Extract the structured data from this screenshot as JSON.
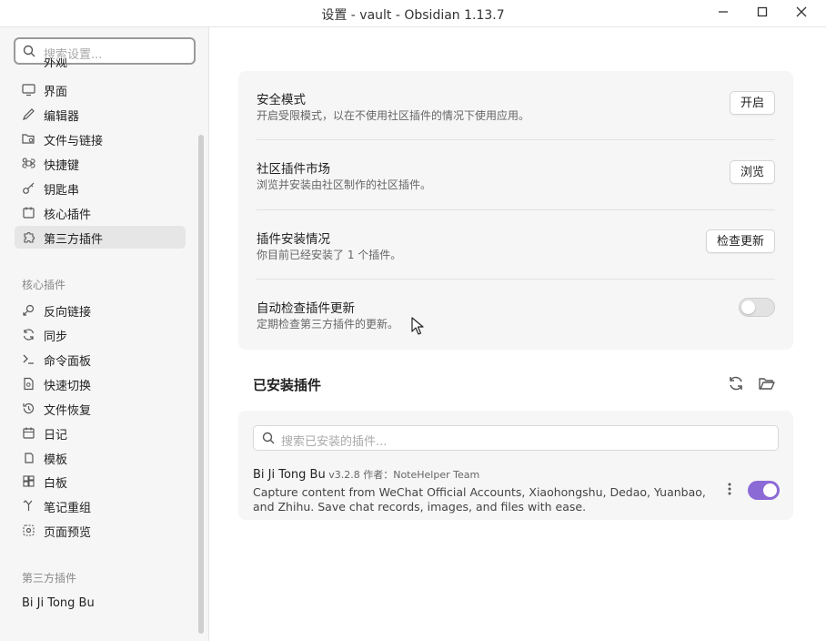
{
  "window": {
    "title": "设置 - vault - Obsidian 1.13.7"
  },
  "sidebar": {
    "search_placeholder": "搜索设置...",
    "partial_item": "外观",
    "items": [
      {
        "label": "界面",
        "icon": "monitor-icon"
      },
      {
        "label": "编辑器",
        "icon": "pen-icon"
      },
      {
        "label": "文件与链接",
        "icon": "folder-cog-icon"
      },
      {
        "label": "快捷键",
        "icon": "command-icon"
      },
      {
        "label": "钥匙串",
        "icon": "key-icon"
      },
      {
        "label": "核心插件",
        "icon": "calendar-icon"
      },
      {
        "label": "第三方插件",
        "icon": "puzzle-icon",
        "active": true
      }
    ],
    "core_heading": "核心插件",
    "core_items": [
      {
        "label": "反向链接",
        "icon": "backlink-icon"
      },
      {
        "label": "同步",
        "icon": "sync-icon"
      },
      {
        "label": "命令面板",
        "icon": "terminal-icon"
      },
      {
        "label": "快速切换",
        "icon": "file-search-icon"
      },
      {
        "label": "文件恢复",
        "icon": "history-icon"
      },
      {
        "label": "日记",
        "icon": "calendar-icon"
      },
      {
        "label": "模板",
        "icon": "template-icon"
      },
      {
        "label": "白板",
        "icon": "canvas-icon"
      },
      {
        "label": "笔记重组",
        "icon": "merge-icon"
      },
      {
        "label": "页面预览",
        "icon": "preview-icon"
      }
    ],
    "community_heading": "第三方插件",
    "community_items": [
      "Bi Ji Tong Bu"
    ]
  },
  "settings": [
    {
      "name": "安全模式",
      "desc": "开启受限模式，以在不使用社区插件的情况下使用应用。",
      "button": "开启"
    },
    {
      "name": "社区插件市场",
      "desc": "浏览并安装由社区制作的社区插件。",
      "button": "浏览"
    },
    {
      "name": "插件安装情况",
      "desc": "你目前已经安装了 1 个插件。",
      "button": "检查更新"
    },
    {
      "name": "自动检查插件更新",
      "desc": "定期检查第三方插件的更新。",
      "toggle_on": false
    }
  ],
  "installed": {
    "title": "已安装插件",
    "search_placeholder": "搜索已安装的插件...",
    "plugin": {
      "name": "Bi Ji Tong Bu",
      "meta": " v3.2.8 作者：NoteHelper Team",
      "desc": "Capture content from WeChat Official Accounts, Xiaohongshu, Dedao, Yuanbao, and Zhihu. Save chat records, images, and files with ease.",
      "enabled": true
    }
  },
  "colors": {
    "accent": "#8c6ad6",
    "sidebar_bg": "#f6f6f6",
    "card_bg": "#f6f6f6"
  }
}
